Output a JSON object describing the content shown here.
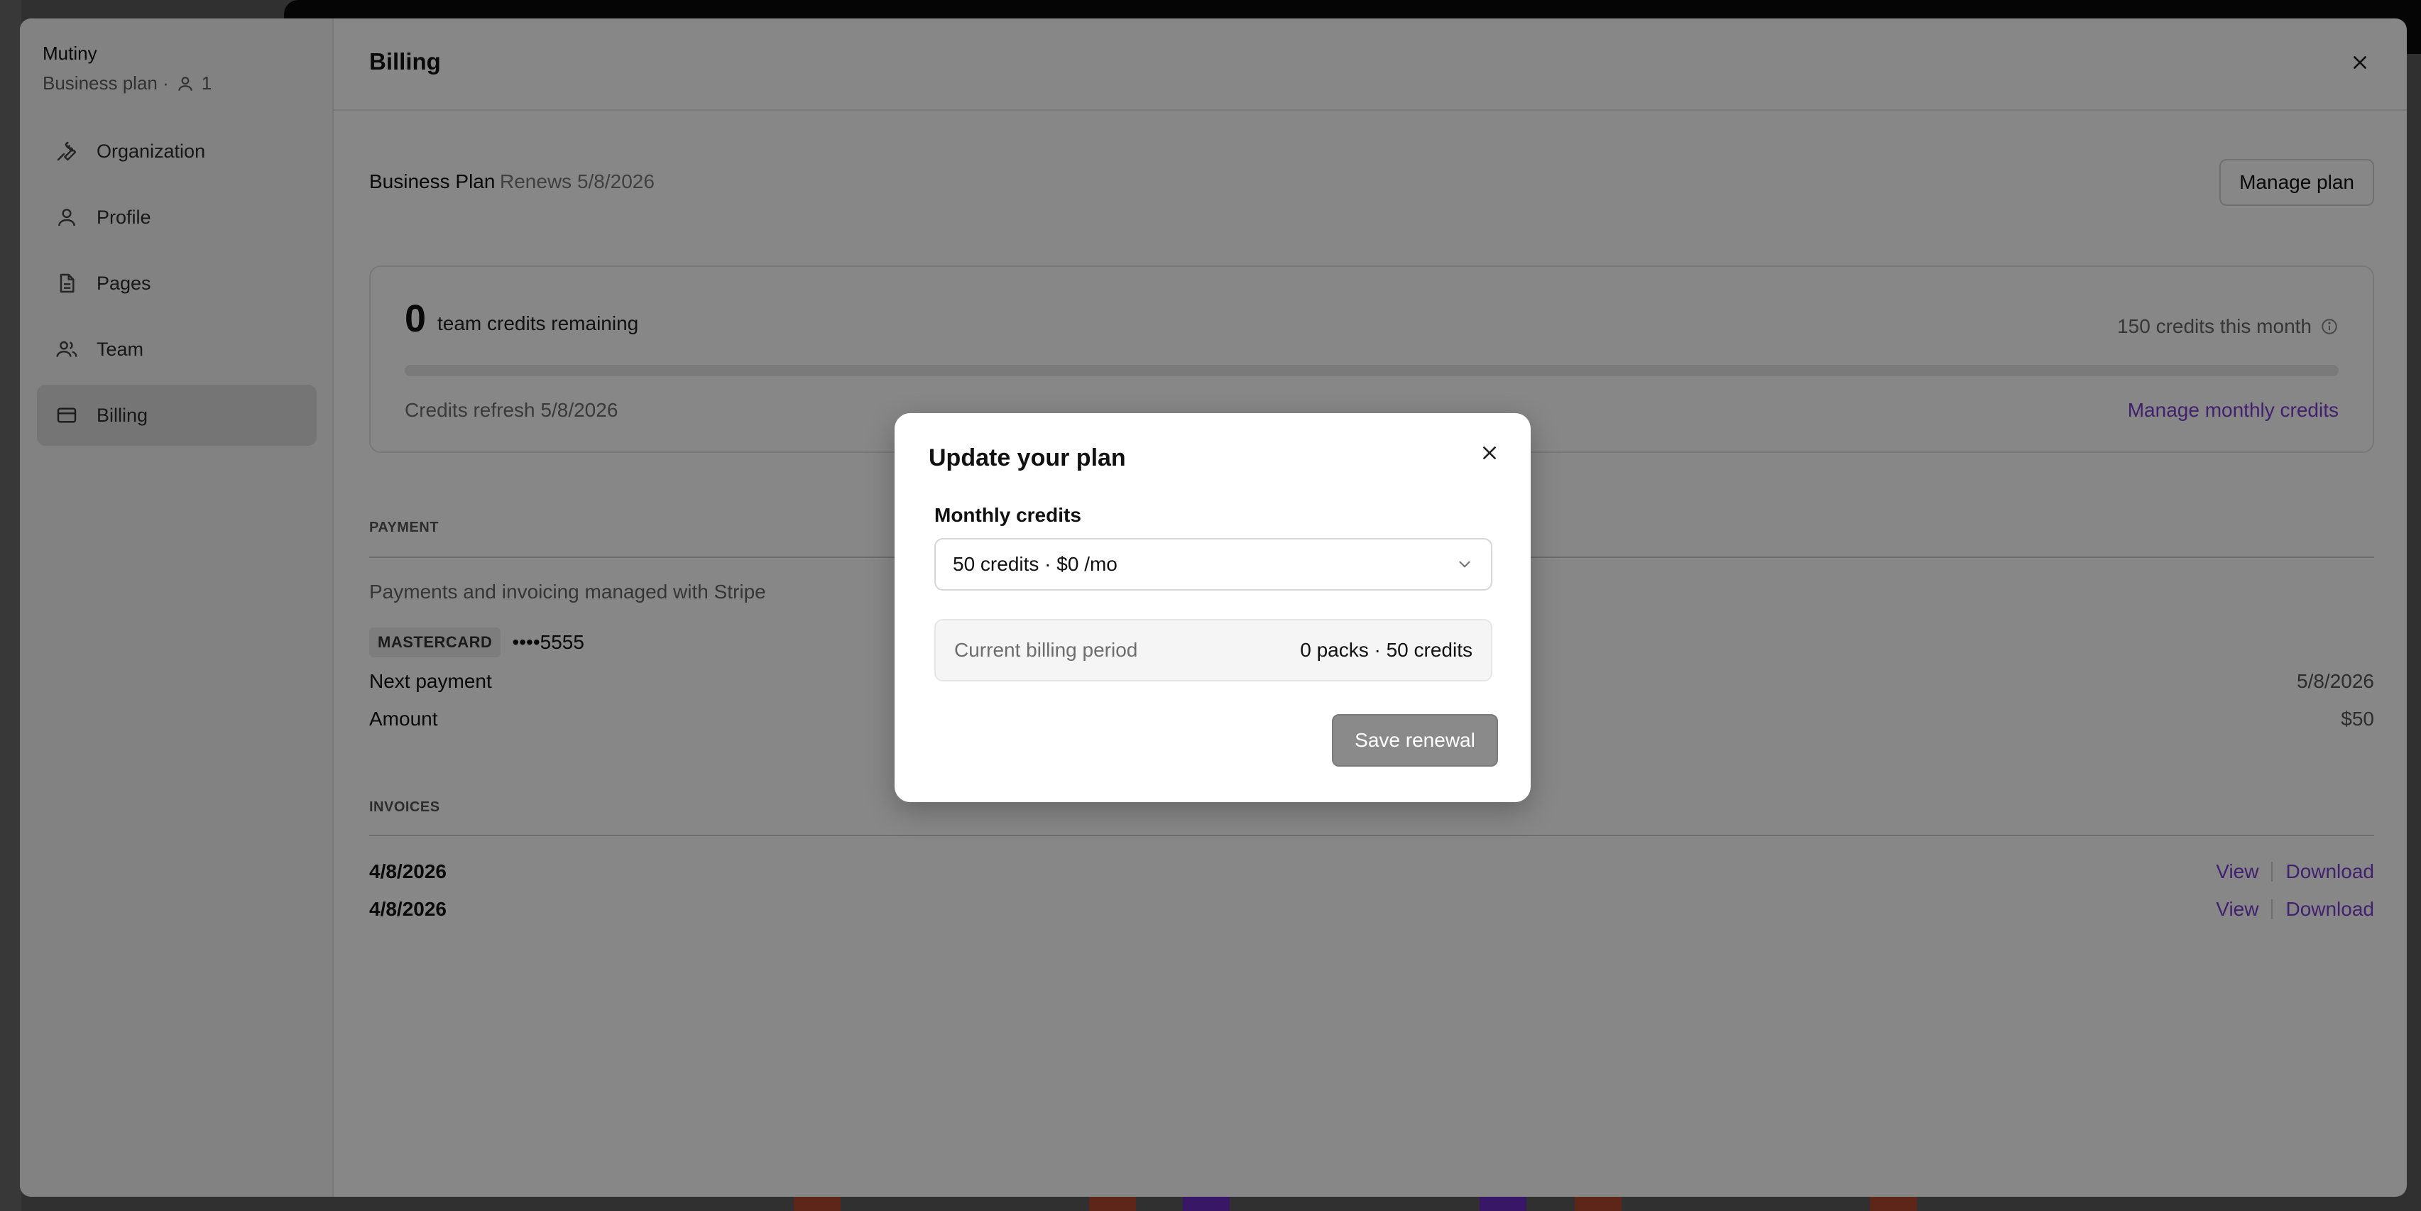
{
  "colors": {
    "accent": "#7b3fd1",
    "overlay": "rgba(0,0,0,0.47)",
    "active_nav": "#dedede"
  },
  "sidebar": {
    "org_name": "Mutiny",
    "plan_label": "Business plan ·",
    "member_count": "1",
    "items": [
      {
        "label": "Organization",
        "icon": "wrench-icon",
        "active": false
      },
      {
        "label": "Profile",
        "icon": "user-icon",
        "active": false
      },
      {
        "label": "Pages",
        "icon": "document-icon",
        "active": false
      },
      {
        "label": "Team",
        "icon": "users-icon",
        "active": false
      },
      {
        "label": "Billing",
        "icon": "credit-card-icon",
        "active": true
      }
    ]
  },
  "header": {
    "title": "Billing"
  },
  "plan": {
    "name": "Business Plan",
    "renews": "Renews 5/8/2026",
    "manage_button": "Manage plan"
  },
  "credits": {
    "remaining": "0",
    "remaining_label": "team credits remaining",
    "monthly": "150 credits this month",
    "progress_fraction": 0,
    "refresh": "Credits refresh 5/8/2026",
    "manage_link": "Manage monthly credits"
  },
  "payment": {
    "section_label": "PAYMENT",
    "provider_text": "Payments and invoicing managed with Stripe",
    "card_brand": "MASTERCARD",
    "card_number": "••••5555",
    "next_payment_label": "Next payment",
    "next_payment_value": "5/8/2026",
    "amount_label": "Amount",
    "amount_value": "$50"
  },
  "invoices": {
    "section_label": "INVOICES",
    "rows": [
      {
        "date": "4/8/2026",
        "view": "View",
        "download": "Download"
      },
      {
        "date": "4/8/2026",
        "view": "View",
        "download": "Download"
      }
    ]
  },
  "modal": {
    "title": "Update your plan",
    "field_label": "Monthly credits",
    "selected_option": "50 credits · $0 /mo",
    "period_label": "Current billing period",
    "period_value": "0 packs · 50 credits",
    "save_button": "Save renewal"
  }
}
